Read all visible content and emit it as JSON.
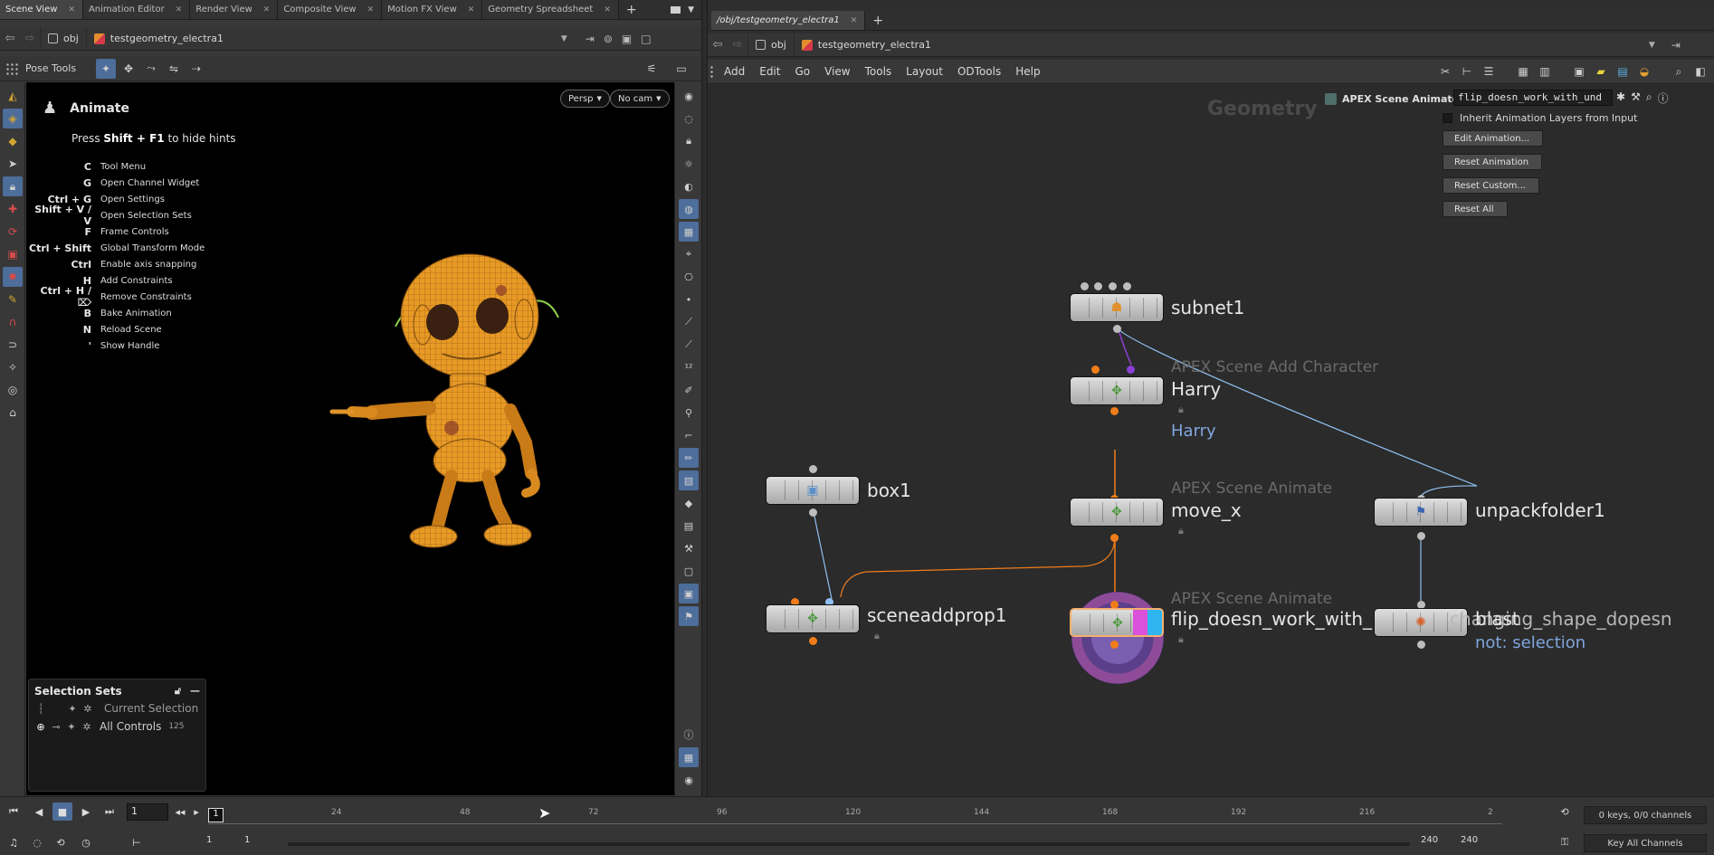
{
  "scene_view": {
    "tabs": [
      {
        "label": "Scene View",
        "active": true
      },
      {
        "label": "Animation Editor",
        "active": false
      },
      {
        "label": "Render View",
        "active": false
      },
      {
        "label": "Composite View",
        "active": false
      },
      {
        "label": "Motion FX View",
        "active": false
      },
      {
        "label": "Geometry Spreadsheet",
        "active": false
      }
    ],
    "path": {
      "context": "obj",
      "node": "testgeometry_electra1"
    },
    "pose_tools_label": "Pose Tools",
    "viewport": {
      "state_title": "Animate",
      "hint_pre": "Press ",
      "hint_key": "Shift + F1",
      "hint_post": " to hide hints",
      "persp_label": "Persp",
      "cam_label": "No cam",
      "hotkeys": [
        {
          "key": "C",
          "desc": "Tool Menu"
        },
        {
          "key": "G",
          "desc": "Open Channel Widget"
        },
        {
          "key": "Ctrl + G",
          "desc": "Open Settings"
        },
        {
          "key": "Shift + V / V",
          "desc": "Open Selection Sets"
        },
        {
          "key": "F",
          "desc": "Frame Controls"
        },
        {
          "key": "Ctrl + Shift",
          "desc": "Global Transform Mode"
        },
        {
          "key": "Ctrl",
          "desc": "Enable axis snapping"
        },
        {
          "key": "H",
          "desc": "Add Constraints"
        },
        {
          "key": "Ctrl + H / ⌦",
          "desc": "Remove Constraints"
        },
        {
          "key": "B",
          "desc": "Bake Animation"
        },
        {
          "key": "N",
          "desc": "Reload Scene"
        },
        {
          "key": "'",
          "desc": "Show Handle"
        }
      ]
    },
    "selection_sets": {
      "title": "Selection Sets",
      "items": [
        {
          "label": "Current Selection",
          "count": ""
        },
        {
          "label": "All Controls",
          "count": "125"
        }
      ]
    }
  },
  "network": {
    "tab_label": "/obj/testgeometry_electra1",
    "path": {
      "context": "obj",
      "node": "testgeometry_electra1"
    },
    "menu": [
      "Add",
      "Edit",
      "Go",
      "View",
      "Tools",
      "Layout",
      "ODTools",
      "Help"
    ],
    "context_label": "Geometry",
    "params": {
      "node_type": "APEX Scene Animate",
      "node_name": "flip_doesn_work_with_und",
      "inherit_label": "Inherit Animation Layers from Input",
      "buttons": [
        "Edit Animation...",
        "Reset Animation",
        "Reset Custom...",
        "Reset All"
      ]
    },
    "nodes": {
      "subnet1": {
        "name": "subnet1"
      },
      "harry": {
        "type": "APEX Scene Add Character",
        "name": "Harry",
        "comment": "Harry"
      },
      "move_x": {
        "type": "APEX Scene Animate",
        "name": "move_x"
      },
      "box1": {
        "name": "box1"
      },
      "unpackfolder1": {
        "name": "unpackfolder1"
      },
      "sceneaddprop1": {
        "name": "sceneaddprop1"
      },
      "flip": {
        "type": "APEX Scene Animate",
        "name": "flip_doesn_work_with_"
      },
      "blast": {
        "name": "blast",
        "overlap_name": "changing_shape_dopesn",
        "comment": "not: selection"
      }
    }
  },
  "timeline": {
    "current_frame": "1",
    "ruler_current": "1",
    "ticks": [
      "24",
      "48",
      "72",
      "96",
      "120",
      "144",
      "168",
      "192",
      "216",
      "2"
    ],
    "keys_status": "0 keys, 0/0 channels",
    "range_start": "1",
    "range_start2": "1",
    "range_end": "240",
    "range_end2": "240",
    "key_all_label": "Key All Channels"
  },
  "colors": {
    "selected_button": "#4d6d9a",
    "wire_orange": "#f07d1a",
    "wire_blue": "#8fc0f0",
    "wire_purple": "#8c3fd6",
    "comment_blue": "#7fa6dd"
  }
}
